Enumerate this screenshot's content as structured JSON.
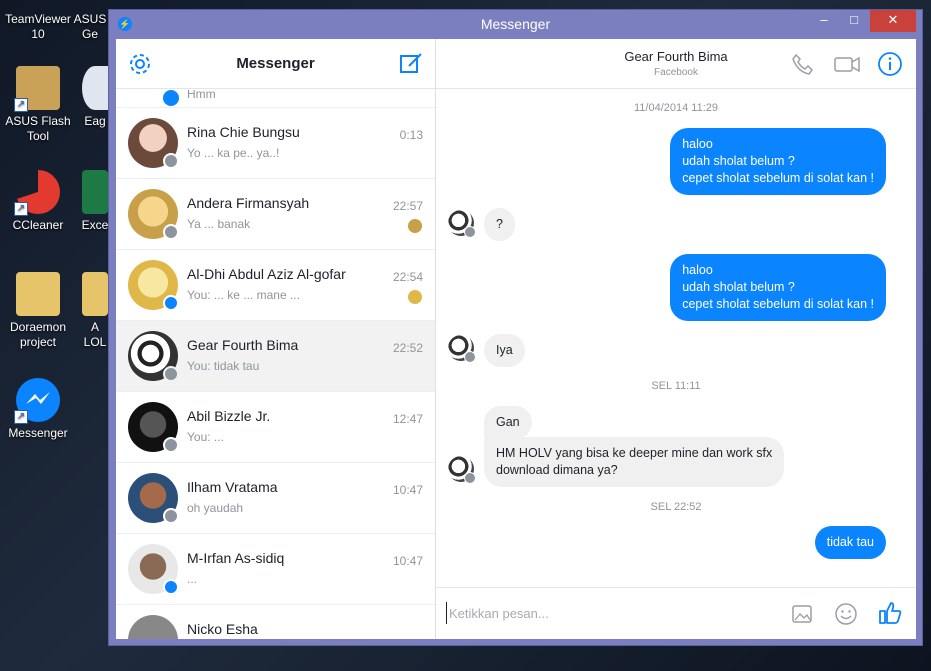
{
  "desktop": {
    "icons": [
      {
        "label": "TeamViewer\n10"
      },
      {
        "label": "ASUS\nGe"
      },
      {
        "label": "ASUS Flash\nTool"
      },
      {
        "label": "Eag"
      },
      {
        "label": "CCleaner"
      },
      {
        "label": "Exce"
      },
      {
        "label": "Doraemon\nproject"
      },
      {
        "label": "A\nLOL"
      },
      {
        "label": "Messenger"
      }
    ]
  },
  "window": {
    "title": "Messenger",
    "controls": {
      "minimize": "–",
      "maximize": "□",
      "close": "✕"
    }
  },
  "left_panel": {
    "title": "Messenger",
    "settings_icon": "gear-icon",
    "compose_icon": "compose-icon",
    "partial_top_snippet": "Hmm",
    "conversations": [
      {
        "name": "Rina Chie Bungsu",
        "snippet": "Yo ... ka pe.. ya..!",
        "time": "0:13",
        "badge": "fb"
      },
      {
        "name": "Andera Firmansyah",
        "snippet": "Ya ... banak",
        "time": "22:57",
        "badge": "fb"
      },
      {
        "name": "Al-Dhi Abdul Aziz Al-gofar",
        "snippet": "You: ... ke ... mane ...",
        "time": "22:54",
        "badge": "ms"
      },
      {
        "name": "Gear Fourth Bima",
        "snippet": "You: tidak tau",
        "time": "22:52",
        "badge": "fb"
      },
      {
        "name": "Abil Bizzle Jr.",
        "snippet": "You: ...",
        "time": "12:47",
        "badge": "fb"
      },
      {
        "name": "Ilham Vratama",
        "snippet": "oh yaudah",
        "time": "10:47",
        "badge": "fb"
      },
      {
        "name": "M-Irfan As-sidiq",
        "snippet": "...",
        "time": "10:47",
        "badge": "ms"
      },
      {
        "name": "Nicko Esha",
        "snippet": "",
        "time": "",
        "badge": "fb"
      }
    ]
  },
  "chat": {
    "contact_name": "Gear Fourth Bima",
    "contact_sub": "Facebook",
    "stamps": [
      "11/04/2014 11:29",
      "SEL 11:11",
      "SEL 22:52"
    ],
    "messages": [
      {
        "dir": "out",
        "text": "haloo\nudah sholat belum ?\ncepet sholat sebelum di solat kan !"
      },
      {
        "dir": "in",
        "text": "?"
      },
      {
        "dir": "out",
        "text": "haloo\nudah sholat belum ?\ncepet sholat sebelum di solat kan !"
      },
      {
        "dir": "in",
        "text": "Iya"
      },
      {
        "dir": "in",
        "text": "Gan"
      },
      {
        "dir": "in",
        "text": "HM HOLV yang bisa ke deeper mine dan work sfx\ndownload dimana ya?"
      },
      {
        "dir": "out",
        "text": "tidak tau"
      }
    ],
    "composer_placeholder": "Ketikkan pesan...",
    "icons": [
      "phone-icon",
      "video-icon",
      "info-icon",
      "image-icon",
      "emoji-icon",
      "like-icon"
    ]
  },
  "colors": {
    "accent": "#0a84ff",
    "titlebar": "#7c7fbf",
    "close": "#c8413a"
  }
}
